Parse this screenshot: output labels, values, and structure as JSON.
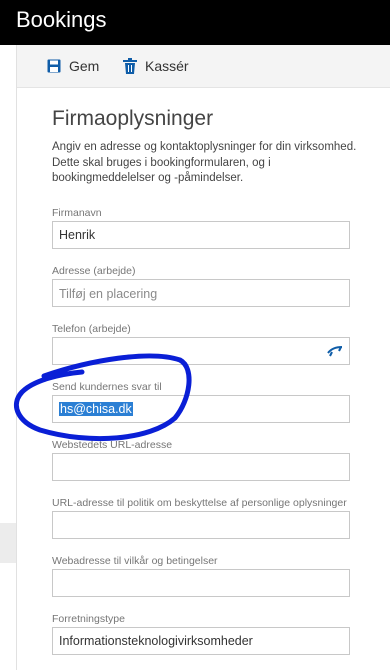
{
  "app": {
    "title": "Bookings"
  },
  "toolbar": {
    "save_label": "Gem",
    "discard_label": "Kassér"
  },
  "section": {
    "title": "Firmaoplysninger",
    "description": "Angiv en adresse og kontaktoplysninger for din virksomhed. Dette skal bruges i bookingformularen, og i bookingmeddelelser og -påmindelser."
  },
  "fields": {
    "company_name": {
      "label": "Firmanavn",
      "value": "Henrik"
    },
    "address": {
      "label": "Adresse (arbejde)",
      "placeholder": "Tilføj en placering"
    },
    "phone": {
      "label": "Telefon (arbejde)",
      "value": ""
    },
    "reply_to": {
      "label": "Send kundernes svar til",
      "value": "hs@chisa.dk"
    },
    "website": {
      "label": "Webstedets URL-adresse",
      "value": ""
    },
    "privacy_url": {
      "label": "URL-adresse til politik om beskyttelse af personlige oplysninger",
      "value": ""
    },
    "terms_url": {
      "label": "Webadresse til vilkår og betingelser",
      "value": ""
    },
    "business_type": {
      "label": "Forretningstype",
      "value": "Informationsteknologivirksomheder"
    }
  },
  "colors": {
    "appbar": "#000000",
    "accent": "#0f5da8",
    "annotation": "#0a1fd6"
  },
  "icons": {
    "save": "save-icon",
    "discard": "trash-icon",
    "phone": "phone-icon"
  }
}
